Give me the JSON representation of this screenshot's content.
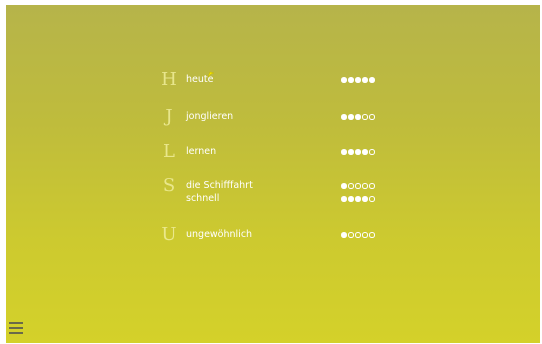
{
  "groups": [
    {
      "letter": "H",
      "entries": [
        {
          "word": "heute",
          "level": 5,
          "max": 5
        }
      ]
    },
    {
      "letter": "J",
      "entries": [
        {
          "word": "jonglieren",
          "level": 3,
          "max": 5
        }
      ]
    },
    {
      "letter": "L",
      "entries": [
        {
          "word": "lernen",
          "level": 4,
          "max": 5
        }
      ]
    },
    {
      "letter": "S",
      "entries": [
        {
          "word": "die Schifffahrt",
          "level": 1,
          "max": 5
        },
        {
          "word": "schnell",
          "level": 4,
          "max": 5
        }
      ]
    },
    {
      "letter": "U",
      "entries": [
        {
          "word": "ungewöhnlich",
          "level": 1,
          "max": 5
        }
      ]
    }
  ],
  "colors": {
    "background_top": "#b6b44a",
    "background_bottom": "#d4d12a",
    "text": "#ffffff",
    "letter": "#f0ee9a",
    "highlight": "#f2e600"
  },
  "icons": {
    "menu": "hamburger-menu-icon",
    "cursor": "pointer-cursor-icon"
  }
}
